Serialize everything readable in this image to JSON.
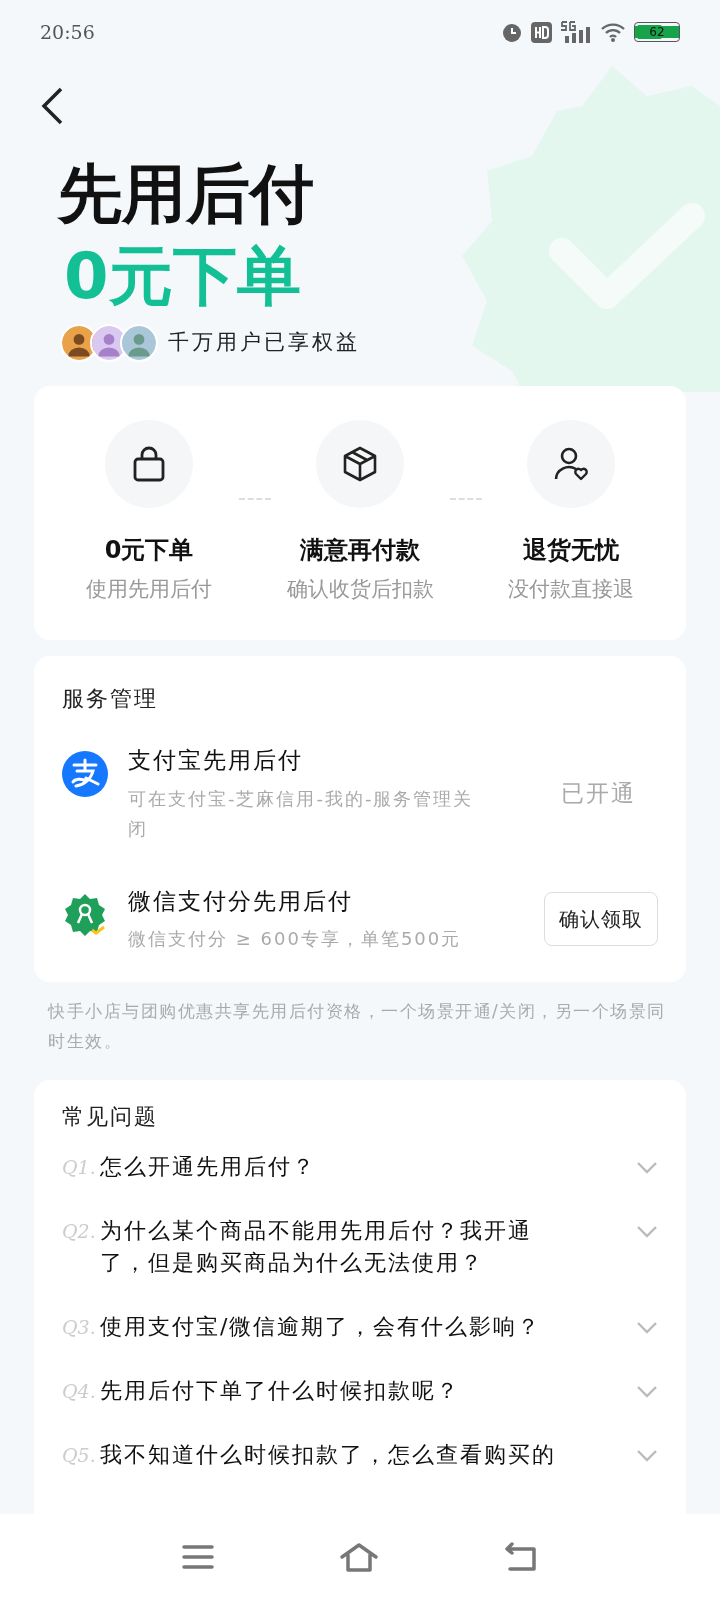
{
  "status_bar": {
    "time": "20:56",
    "battery": "62"
  },
  "hero": {
    "title": "先用后付",
    "subtitle": "0元下单",
    "users_text": "千万用户已享权益"
  },
  "features": [
    {
      "title": "0元下单",
      "desc": "使用先用后付"
    },
    {
      "title": "满意再付款",
      "desc": "确认收货后扣款"
    },
    {
      "title": "退货无忧",
      "desc": "没付款直接退"
    }
  ],
  "service": {
    "title": "服务管理",
    "items": [
      {
        "kind": "status",
        "name": "支付宝先用后付",
        "desc": "可在支付宝-芝麻信用-我的-服务管理关闭",
        "action": "已开通"
      },
      {
        "kind": "button",
        "name": "微信支付分先用后付",
        "desc": "微信支付分 ≥ 600专享，单笔500元",
        "action": "确认领取"
      }
    ]
  },
  "note": "快手小店与团购优惠共享先用后付资格，一个场景开通/关闭，另一个场景同时生效。",
  "faq": {
    "title": "常见问题",
    "items": [
      {
        "index": "Q1.",
        "question": "怎么开通先用后付？",
        "expanded": false
      },
      {
        "index": "Q2.",
        "question": "为什么某个商品不能用先用后付？我开通了，但是购买商品为什么无法使用？",
        "expanded": false
      },
      {
        "index": "Q3.",
        "question": "使用支付宝/微信逾期了，会有什么影响？",
        "expanded": false
      },
      {
        "index": "Q4.",
        "question": "先用后付下单了什么时候扣款呢？",
        "expanded": false
      },
      {
        "index": "Q5.",
        "question": "我不知道什么时候扣款了，怎么查看购买的",
        "expanded": false
      }
    ]
  }
}
